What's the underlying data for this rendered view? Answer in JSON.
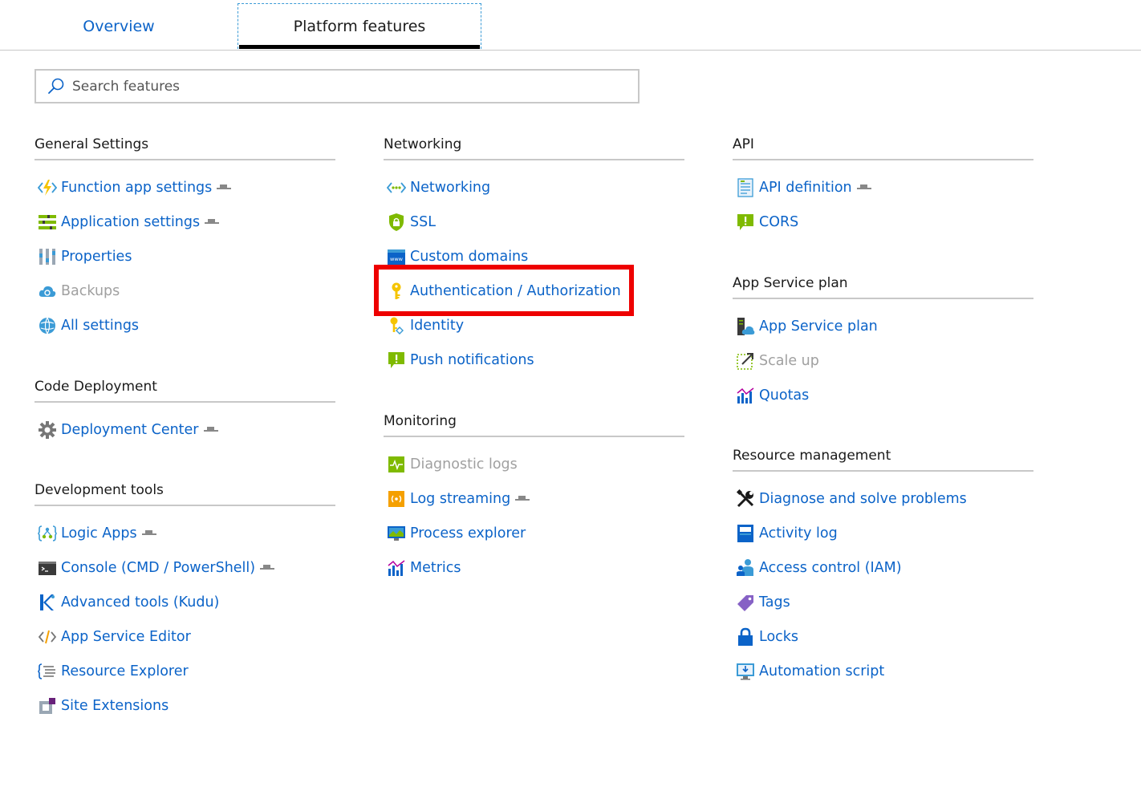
{
  "tabs": [
    {
      "label": "Overview"
    },
    {
      "label": "Platform features",
      "active": true
    }
  ],
  "search": {
    "placeholder": "Search features",
    "value": ""
  },
  "highlight": {
    "target": "Authentication / Authorization",
    "color": "#ee0000"
  },
  "colors": {
    "link": "#0b63c8",
    "disabled": "#a0a0a0"
  },
  "sections": {
    "general": {
      "title": "General Settings",
      "items": [
        {
          "label": "Function app settings",
          "icon": "function-bolt-icon",
          "preview": true
        },
        {
          "label": "Application settings",
          "icon": "app-settings-icon",
          "preview": true
        },
        {
          "label": "Properties",
          "icon": "properties-icon"
        },
        {
          "label": "Backups",
          "icon": "backups-cloud-icon",
          "disabled": true
        },
        {
          "label": "All settings",
          "icon": "globe-settings-icon"
        }
      ]
    },
    "code": {
      "title": "Code Deployment",
      "items": [
        {
          "label": "Deployment Center",
          "icon": "gear-icon",
          "preview": true
        }
      ]
    },
    "dev": {
      "title": "Development tools",
      "items": [
        {
          "label": "Logic Apps",
          "icon": "logic-apps-icon",
          "preview": true
        },
        {
          "label": "Console (CMD / PowerShell)",
          "icon": "console-icon",
          "preview": true
        },
        {
          "label": "Advanced tools (Kudu)",
          "icon": "kudu-icon"
        },
        {
          "label": "App Service Editor",
          "icon": "code-editor-icon"
        },
        {
          "label": "Resource Explorer",
          "icon": "resource-explorer-icon"
        },
        {
          "label": "Site Extensions",
          "icon": "extensions-icon"
        }
      ]
    },
    "networking": {
      "title": "Networking",
      "items": [
        {
          "label": "Networking",
          "icon": "networking-icon"
        },
        {
          "label": "SSL",
          "icon": "ssl-shield-icon"
        },
        {
          "label": "Custom domains",
          "icon": "www-icon"
        },
        {
          "label": "Authentication / Authorization",
          "icon": "key-icon"
        },
        {
          "label": "Identity",
          "icon": "identity-key-icon"
        },
        {
          "label": "Push notifications",
          "icon": "push-notification-icon"
        }
      ]
    },
    "monitoring": {
      "title": "Monitoring",
      "items": [
        {
          "label": "Diagnostic logs",
          "icon": "diagnostic-logs-icon",
          "disabled": true
        },
        {
          "label": "Log streaming",
          "icon": "log-streaming-icon",
          "preview": true
        },
        {
          "label": "Process explorer",
          "icon": "process-explorer-icon"
        },
        {
          "label": "Metrics",
          "icon": "metrics-icon"
        }
      ]
    },
    "api": {
      "title": "API",
      "items": [
        {
          "label": "API definition",
          "icon": "api-definition-icon",
          "preview": true
        },
        {
          "label": "CORS",
          "icon": "cors-icon"
        }
      ]
    },
    "plan": {
      "title": "App Service plan",
      "items": [
        {
          "label": "App Service plan",
          "icon": "app-service-plan-icon"
        },
        {
          "label": "Scale up",
          "icon": "scale-up-icon",
          "disabled": true
        },
        {
          "label": "Quotas",
          "icon": "quotas-icon"
        }
      ]
    },
    "resource": {
      "title": "Resource management",
      "items": [
        {
          "label": "Diagnose and solve problems",
          "icon": "tools-icon"
        },
        {
          "label": "Activity log",
          "icon": "activity-log-icon"
        },
        {
          "label": "Access control (IAM)",
          "icon": "access-control-icon"
        },
        {
          "label": "Tags",
          "icon": "tag-icon"
        },
        {
          "label": "Locks",
          "icon": "lock-icon"
        },
        {
          "label": "Automation script",
          "icon": "automation-script-icon"
        }
      ]
    }
  }
}
